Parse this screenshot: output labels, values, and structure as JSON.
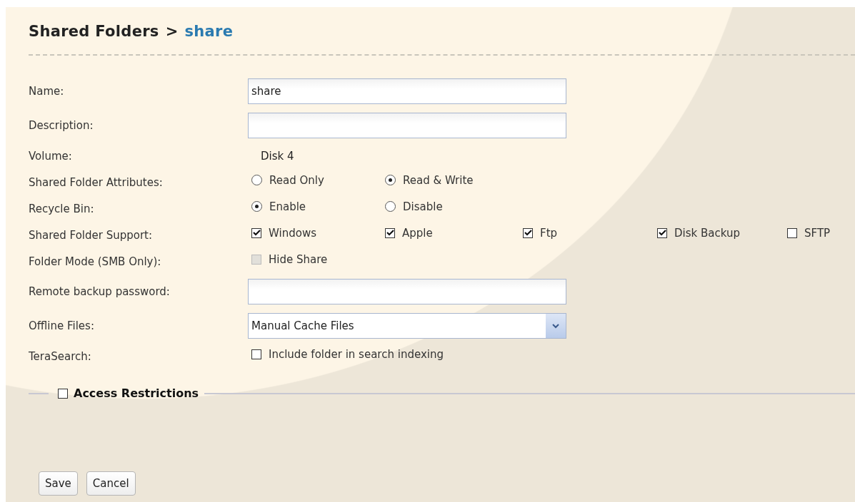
{
  "breadcrumb": {
    "parent": "Shared Folders",
    "separator": ">",
    "current": "share"
  },
  "fields": [
    {
      "kind": "text",
      "label": "Name:",
      "value": "share"
    },
    {
      "kind": "text",
      "label": "Description:"
    },
    {
      "kind": "static",
      "label": "Volume:",
      "value": "Disk 4"
    },
    {
      "kind": "radio",
      "label": "Shared Folder Attributes:",
      "options": [
        {
          "label": "Read Only",
          "selected": false
        },
        {
          "label": "Read & Write",
          "selected": true
        }
      ]
    },
    {
      "kind": "radio",
      "label": "Recycle Bin:",
      "options": [
        {
          "label": "Enable",
          "selected": true
        },
        {
          "label": "Disable",
          "selected": false
        }
      ]
    },
    {
      "kind": "check",
      "label": "Shared Folder Support:",
      "options": [
        {
          "label": "Windows",
          "checked": true,
          "disabled": false
        },
        {
          "label": "Apple",
          "checked": true,
          "disabled": false
        },
        {
          "label": "Ftp",
          "checked": true,
          "disabled": false
        },
        {
          "label": "Disk Backup",
          "checked": true,
          "disabled": false
        },
        {
          "label": "SFTP",
          "checked": false,
          "disabled": false
        }
      ]
    },
    {
      "kind": "check",
      "label": "Folder Mode (SMB Only):",
      "options": [
        {
          "label": "Hide Share",
          "checked": false,
          "disabled": true
        }
      ]
    },
    {
      "kind": "text",
      "label": "Remote backup password:"
    },
    {
      "kind": "select",
      "label": "Offline Files:",
      "value": "Manual Cache Files"
    },
    {
      "kind": "check",
      "label": "TeraSearch:",
      "options": [
        {
          "label": "Include folder in search indexing",
          "checked": false,
          "disabled": false
        }
      ]
    }
  ],
  "access_restrictions": {
    "label": "Access Restrictions",
    "checked": false
  },
  "buttons": [
    "Save",
    "Cancel"
  ]
}
